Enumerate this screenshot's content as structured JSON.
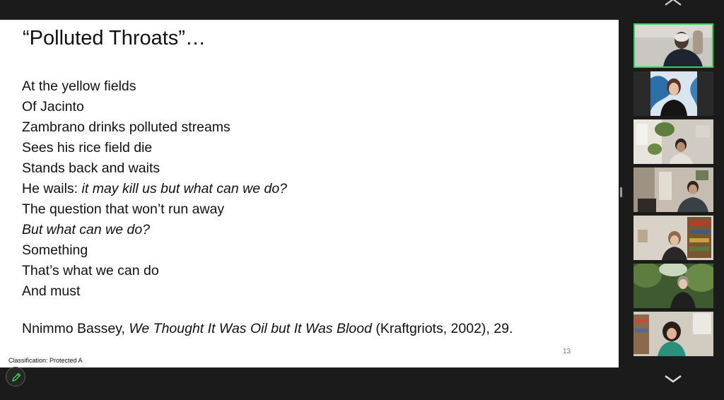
{
  "slide": {
    "title": "“Polluted Throats”…",
    "lines": [
      {
        "plain": "At the yellow fields",
        "italic": ""
      },
      {
        "plain": "Of Jacinto",
        "italic": ""
      },
      {
        "plain": "Zambrano drinks polluted streams",
        "italic": ""
      },
      {
        "plain": "Sees his rice field die",
        "italic": ""
      },
      {
        "plain": "Stands back and waits",
        "italic": ""
      },
      {
        "plain": "He wails: ",
        "italic": "it may kill us but what can we do?"
      },
      {
        "plain": "The question that won’t run away",
        "italic": ""
      },
      {
        "plain": "",
        "italic": "But what can we do?"
      },
      {
        "plain": "Something",
        "italic": ""
      },
      {
        "plain": "That’s what we can do",
        "italic": ""
      },
      {
        "plain": "And must",
        "italic": ""
      }
    ],
    "citation": {
      "author": "Nnimmo Bassey, ",
      "work": "We Thought It Was Oil but It Was Blood",
      "details": " (Kraftgriots, 2002), 29."
    },
    "page_number": "13",
    "classification": "Classification: Protected A"
  },
  "gallery": {
    "participants": [
      {
        "id": "p1",
        "active_speaker": true
      },
      {
        "id": "p2",
        "active_speaker": false
      },
      {
        "id": "p3",
        "active_speaker": false
      },
      {
        "id": "p4",
        "active_speaker": false
      },
      {
        "id": "p5",
        "active_speaker": false
      },
      {
        "id": "p6",
        "active_speaker": false
      },
      {
        "id": "p7",
        "active_speaker": false
      }
    ]
  },
  "controls": {
    "annotate_icon": "pencil-icon",
    "scroll_up_icon": "chevron-up-icon",
    "scroll_down_icon": "chevron-down-icon"
  },
  "colors": {
    "background": "#1b1b1b",
    "slide": "#ffffff",
    "active_speaker_border": "#36d35b",
    "annotate_icon": "#3ccf5d"
  }
}
